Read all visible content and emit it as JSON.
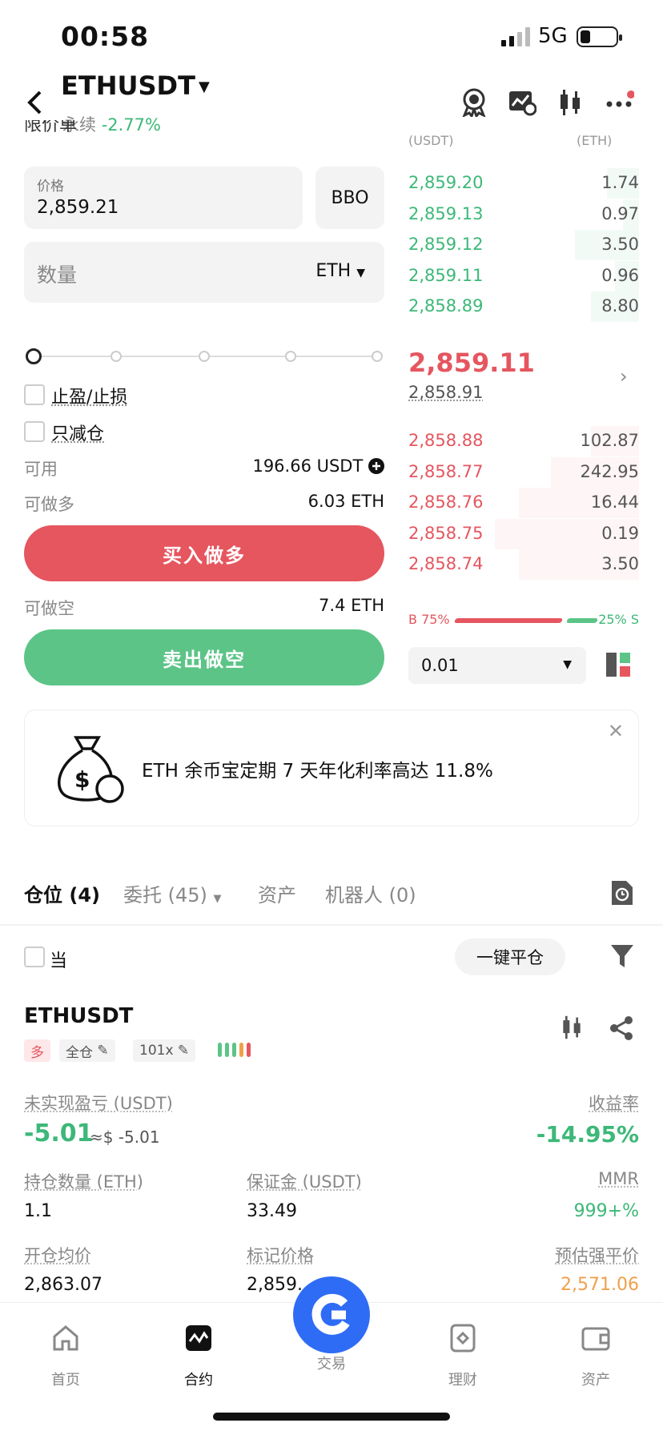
{
  "status_bar": {
    "time": "00:58",
    "network": "5G"
  },
  "header": {
    "symbol": "ETHUSDT",
    "market_type": "永续",
    "change": "-2.77%"
  },
  "order_form": {
    "order_type_hidden": "限价单",
    "price_label": "价格",
    "price_value": "2,859.21",
    "bbo_label": "BBO",
    "qty_placeholder": "数量",
    "qty_unit": "ETH",
    "tp_sl_label": "止盈/止损",
    "reduce_only_label": "只减仓",
    "available_label": "可用",
    "available_value": "196.66 USDT",
    "max_long_label": "可做多",
    "max_long_value": "6.03 ETH",
    "buy_label": "买入做多",
    "max_short_label": "可做空",
    "max_short_value": "7.4 ETH",
    "sell_label": "卖出做空",
    "slider_fraction": 0
  },
  "order_book": {
    "header_price": "(USDT)",
    "header_qty": "(ETH)",
    "asks": [
      {
        "price": "2,859.20",
        "qty": "1.74"
      },
      {
        "price": "2,859.13",
        "qty": "0.97"
      },
      {
        "price": "2,859.12",
        "qty": "3.50"
      },
      {
        "price": "2,859.11",
        "qty": "0.96"
      },
      {
        "price": "2,858.89",
        "qty": "8.80"
      }
    ],
    "last_price": "2,859.11",
    "mark_price": "2,858.91",
    "bids": [
      {
        "price": "2,858.88",
        "qty": "102.87"
      },
      {
        "price": "2,858.77",
        "qty": "242.95"
      },
      {
        "price": "2,858.76",
        "qty": "16.44"
      },
      {
        "price": "2,858.75",
        "qty": "0.19"
      },
      {
        "price": "2,858.74",
        "qty": "3.50"
      }
    ],
    "buy_ratio_label": "B 75%",
    "sell_ratio_label": "25% S",
    "buy_ratio": 0.75,
    "depth_value": "0.01"
  },
  "banner": {
    "text": "ETH 余币宝定期 7 天年化利率高达 11.8%"
  },
  "tabs": [
    {
      "label": "仓位 (4)"
    },
    {
      "label": "委托 (45)"
    },
    {
      "label": "资产"
    },
    {
      "label": "机器人 (0)"
    }
  ],
  "positions_toolbar": {
    "current_label": "当",
    "close_all_label": "一键平仓"
  },
  "position": {
    "symbol": "ETHUSDT",
    "side": "多",
    "margin_mode": "全仓",
    "leverage": "101x",
    "upnl_label": "未实现盈亏 (USDT)",
    "upnl_value": "-5.01",
    "upnl_usd": "≈$ -5.01",
    "roe_label": "收益率",
    "roe_value": "-14.95%",
    "size_label": "持仓数量 (ETH)",
    "size_value": "1.1",
    "margin_label": "保证金 (USDT)",
    "margin_value": "33.49",
    "mmr_label": "MMR",
    "mmr_value": "999+%",
    "entry_label": "开仓均价",
    "entry_value": "2,863.07",
    "markp_label": "标记价格",
    "markp_value": "2,859.",
    "liq_label": "预估强平价",
    "liq_value": "2,571.06"
  },
  "nav": [
    {
      "label": "首页"
    },
    {
      "label": "合约"
    },
    {
      "label": "交易"
    },
    {
      "label": "理财"
    },
    {
      "label": "资产"
    }
  ],
  "colors": {
    "buy": "#e5565f",
    "sell": "#5cc487",
    "accent": "#2f6cf6",
    "liq": "#f0a04b"
  }
}
